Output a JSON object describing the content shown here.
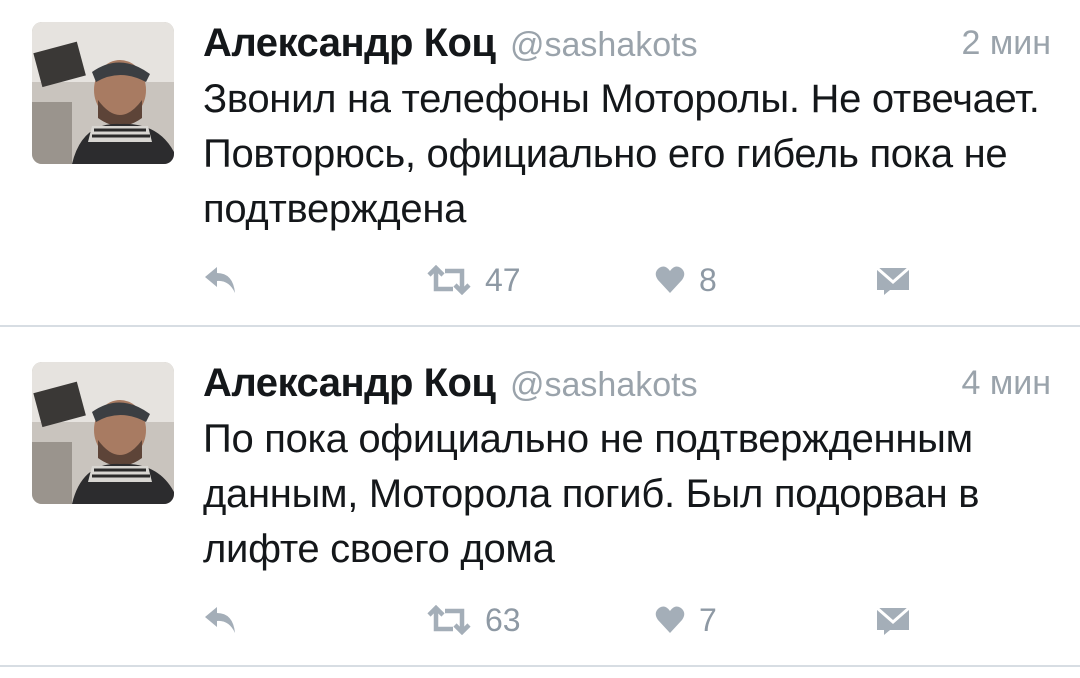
{
  "tweets": [
    {
      "author_name": "Александр Коц",
      "handle": "@sashakots",
      "time": "2 мин",
      "text": "Звонил на телефоны Моторолы. Не отвечает. Повторюсь, официально его гибель пока не подтверждена",
      "retweets": "47",
      "likes": "8"
    },
    {
      "author_name": "Александр Коц",
      "handle": "@sashakots",
      "time": "4 мин",
      "text": "По пока официально не подтвержденным данным, Моторола погиб. Был подорван в лифте своего дома",
      "retweets": "63",
      "likes": "7"
    }
  ],
  "icons": {
    "reply": "reply-icon",
    "retweet": "retweet-icon",
    "like": "heart-icon",
    "message": "direct-message-icon"
  },
  "colors": {
    "text": "#14171a",
    "meta": "#9aa3ab",
    "action": "#a4aeb8",
    "divider": "#d7dde3"
  }
}
